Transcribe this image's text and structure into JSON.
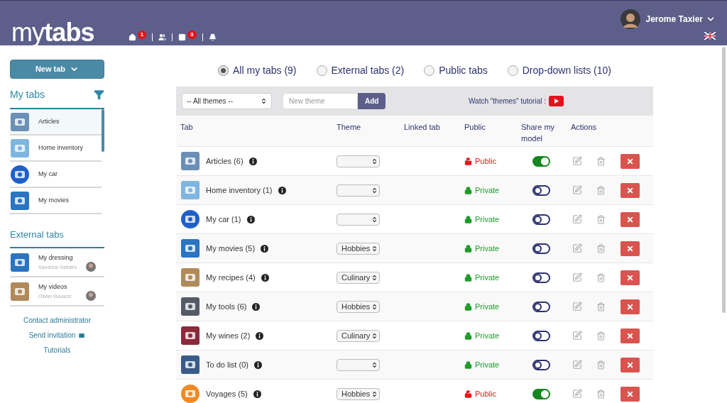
{
  "header": {
    "logo": "my**tabs**",
    "nav": [
      {
        "kind": "home",
        "badge": "1"
      },
      {
        "kind": "users"
      },
      {
        "kind": "image",
        "badge": "3"
      },
      {
        "kind": "bell"
      }
    ],
    "user": {
      "name": "Jerome Taxier"
    }
  },
  "sidebar": {
    "new_tab_button": "New tab",
    "my_tabs": {
      "title": "My tabs",
      "items": [
        {
          "label": "Articles",
          "selected": true
        },
        {
          "label": "Home inventory",
          "selected": false
        },
        {
          "label": "My car",
          "selected": false
        },
        {
          "label": "My movies",
          "selected": false
        }
      ]
    },
    "external_tabs": {
      "title": "External tabs",
      "items": [
        {
          "label": "My dressing",
          "owner": "Sandrine Gellatro"
        },
        {
          "label": "My videos",
          "owner": "Olivier Bouaziz"
        }
      ]
    },
    "links": [
      {
        "label": "Contact administrator",
        "kind": "plain"
      },
      {
        "label": "Send invitation",
        "kind": "mail"
      },
      {
        "label": "Tutorials",
        "kind": "plain"
      }
    ]
  },
  "filters": [
    {
      "label": "All my tabs (9)",
      "selected": true
    },
    {
      "label": "External tabs (2)",
      "selected": false
    },
    {
      "label": "Public tabs",
      "selected": false
    },
    {
      "label": "Drop-down lists (10)",
      "selected": false
    }
  ],
  "toolbar": {
    "theme_select": "-- All themes --",
    "new_theme": {
      "placeholder": "New theme"
    },
    "add_button": "Add",
    "tutorial": "Watch \"themes\" tutorial :"
  },
  "table": {
    "columns": [
      "Tab",
      "Theme",
      "Linked tab",
      "Public",
      "Share my model",
      "Actions"
    ],
    "rows": [
      {
        "tab": "Articles (6)",
        "public": {
          "kind": "public",
          "label": "Public"
        },
        "share": true
      },
      {
        "tab": "Home inventory (1)",
        "public": {
          "kind": "private",
          "label": "Private"
        },
        "share": false
      },
      {
        "tab": "My car (1)",
        "public": {
          "kind": "private",
          "label": "Private"
        },
        "share": false
      },
      {
        "tab": "My movies (5)",
        "theme": "Hobbies",
        "public": {
          "kind": "private",
          "label": "Private"
        },
        "share": false
      },
      {
        "tab": "My recipes (4)",
        "theme": "Culinary",
        "public": {
          "kind": "private",
          "label": "Private"
        },
        "share": false
      },
      {
        "tab": "My tools (6)",
        "theme": "Hobbies",
        "public": {
          "kind": "private",
          "label": "Private"
        },
        "share": false
      },
      {
        "tab": "My wines (2)",
        "theme": "Culinary",
        "public": {
          "kind": "private",
          "label": "Private"
        },
        "share": false
      },
      {
        "tab": "To do list (0)",
        "public": {
          "kind": "private",
          "label": "Private"
        },
        "share": false
      },
      {
        "tab": "Voyages (5)",
        "theme": "Hobbies",
        "public": {
          "kind": "public",
          "label": "Public"
        },
        "share": true
      }
    ]
  }
}
